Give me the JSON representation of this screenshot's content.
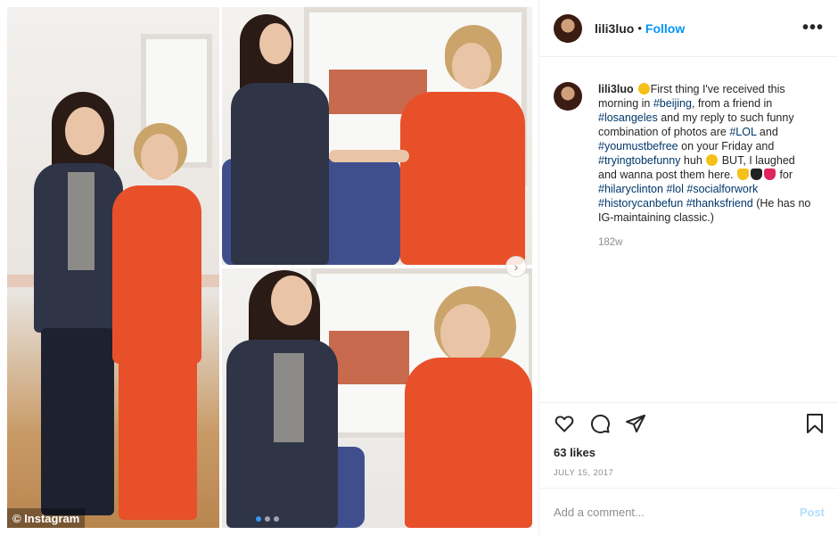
{
  "media": {
    "credit": "© Instagram",
    "carousel_dots": 3,
    "active_dot": 0
  },
  "header": {
    "username": "lili3luo",
    "separator": "•",
    "follow_label": "Follow",
    "more_icon": "more-horizontal-icon"
  },
  "caption": {
    "username": "lili3luo",
    "segments": [
      {
        "t": "emoji",
        "v": "smile"
      },
      {
        "t": "text",
        "v": "First thing I've received this morning in "
      },
      {
        "t": "tag",
        "v": "#beijing"
      },
      {
        "t": "text",
        "v": ", from a friend in "
      },
      {
        "t": "tag",
        "v": "#losangeles"
      },
      {
        "t": "text",
        "v": " and my reply to such funny combination of photos are "
      },
      {
        "t": "tag",
        "v": "#LOL"
      },
      {
        "t": "text",
        "v": " and "
      },
      {
        "t": "tag",
        "v": "#youmustbefree"
      },
      {
        "t": "text",
        "v": " on your Friday and "
      },
      {
        "t": "tag",
        "v": "#tryingtobefunny"
      },
      {
        "t": "text",
        "v": " huh "
      },
      {
        "t": "emoji",
        "v": "grin"
      },
      {
        "t": "text",
        "v": " BUT, I laughed and wanna post them here. "
      },
      {
        "t": "emoji",
        "v": "yellow-heart"
      },
      {
        "t": "emoji",
        "v": "black-heart"
      },
      {
        "t": "emoji",
        "v": "red-heart"
      },
      {
        "t": "text",
        "v": " for "
      },
      {
        "t": "tag",
        "v": "#hilaryclinton"
      },
      {
        "t": "text",
        "v": " "
      },
      {
        "t": "tag",
        "v": "#lol"
      },
      {
        "t": "text",
        "v": " "
      },
      {
        "t": "tag",
        "v": "#socialforwork"
      },
      {
        "t": "text",
        "v": " "
      },
      {
        "t": "tag",
        "v": "#historycanbefun"
      },
      {
        "t": "text",
        "v": " "
      },
      {
        "t": "tag",
        "v": "#thanksfriend"
      },
      {
        "t": "text",
        "v": " (He has no IG-maintaining classic.)"
      }
    ],
    "time_ago": "182w"
  },
  "actions": {
    "like_icon": "heart-icon",
    "comment_icon": "comment-icon",
    "share_icon": "share-icon",
    "save_icon": "bookmark-icon",
    "likes": "63 likes",
    "date": "JULY 15, 2017"
  },
  "comment": {
    "placeholder": "Add a comment...",
    "post_label": "Post"
  },
  "colors": {
    "link_blue": "#0095f6",
    "hashtag_blue": "#00376b",
    "muted_grey": "#8e8e8e",
    "post_disabled": "#b2dffc",
    "border": "#efefef"
  }
}
